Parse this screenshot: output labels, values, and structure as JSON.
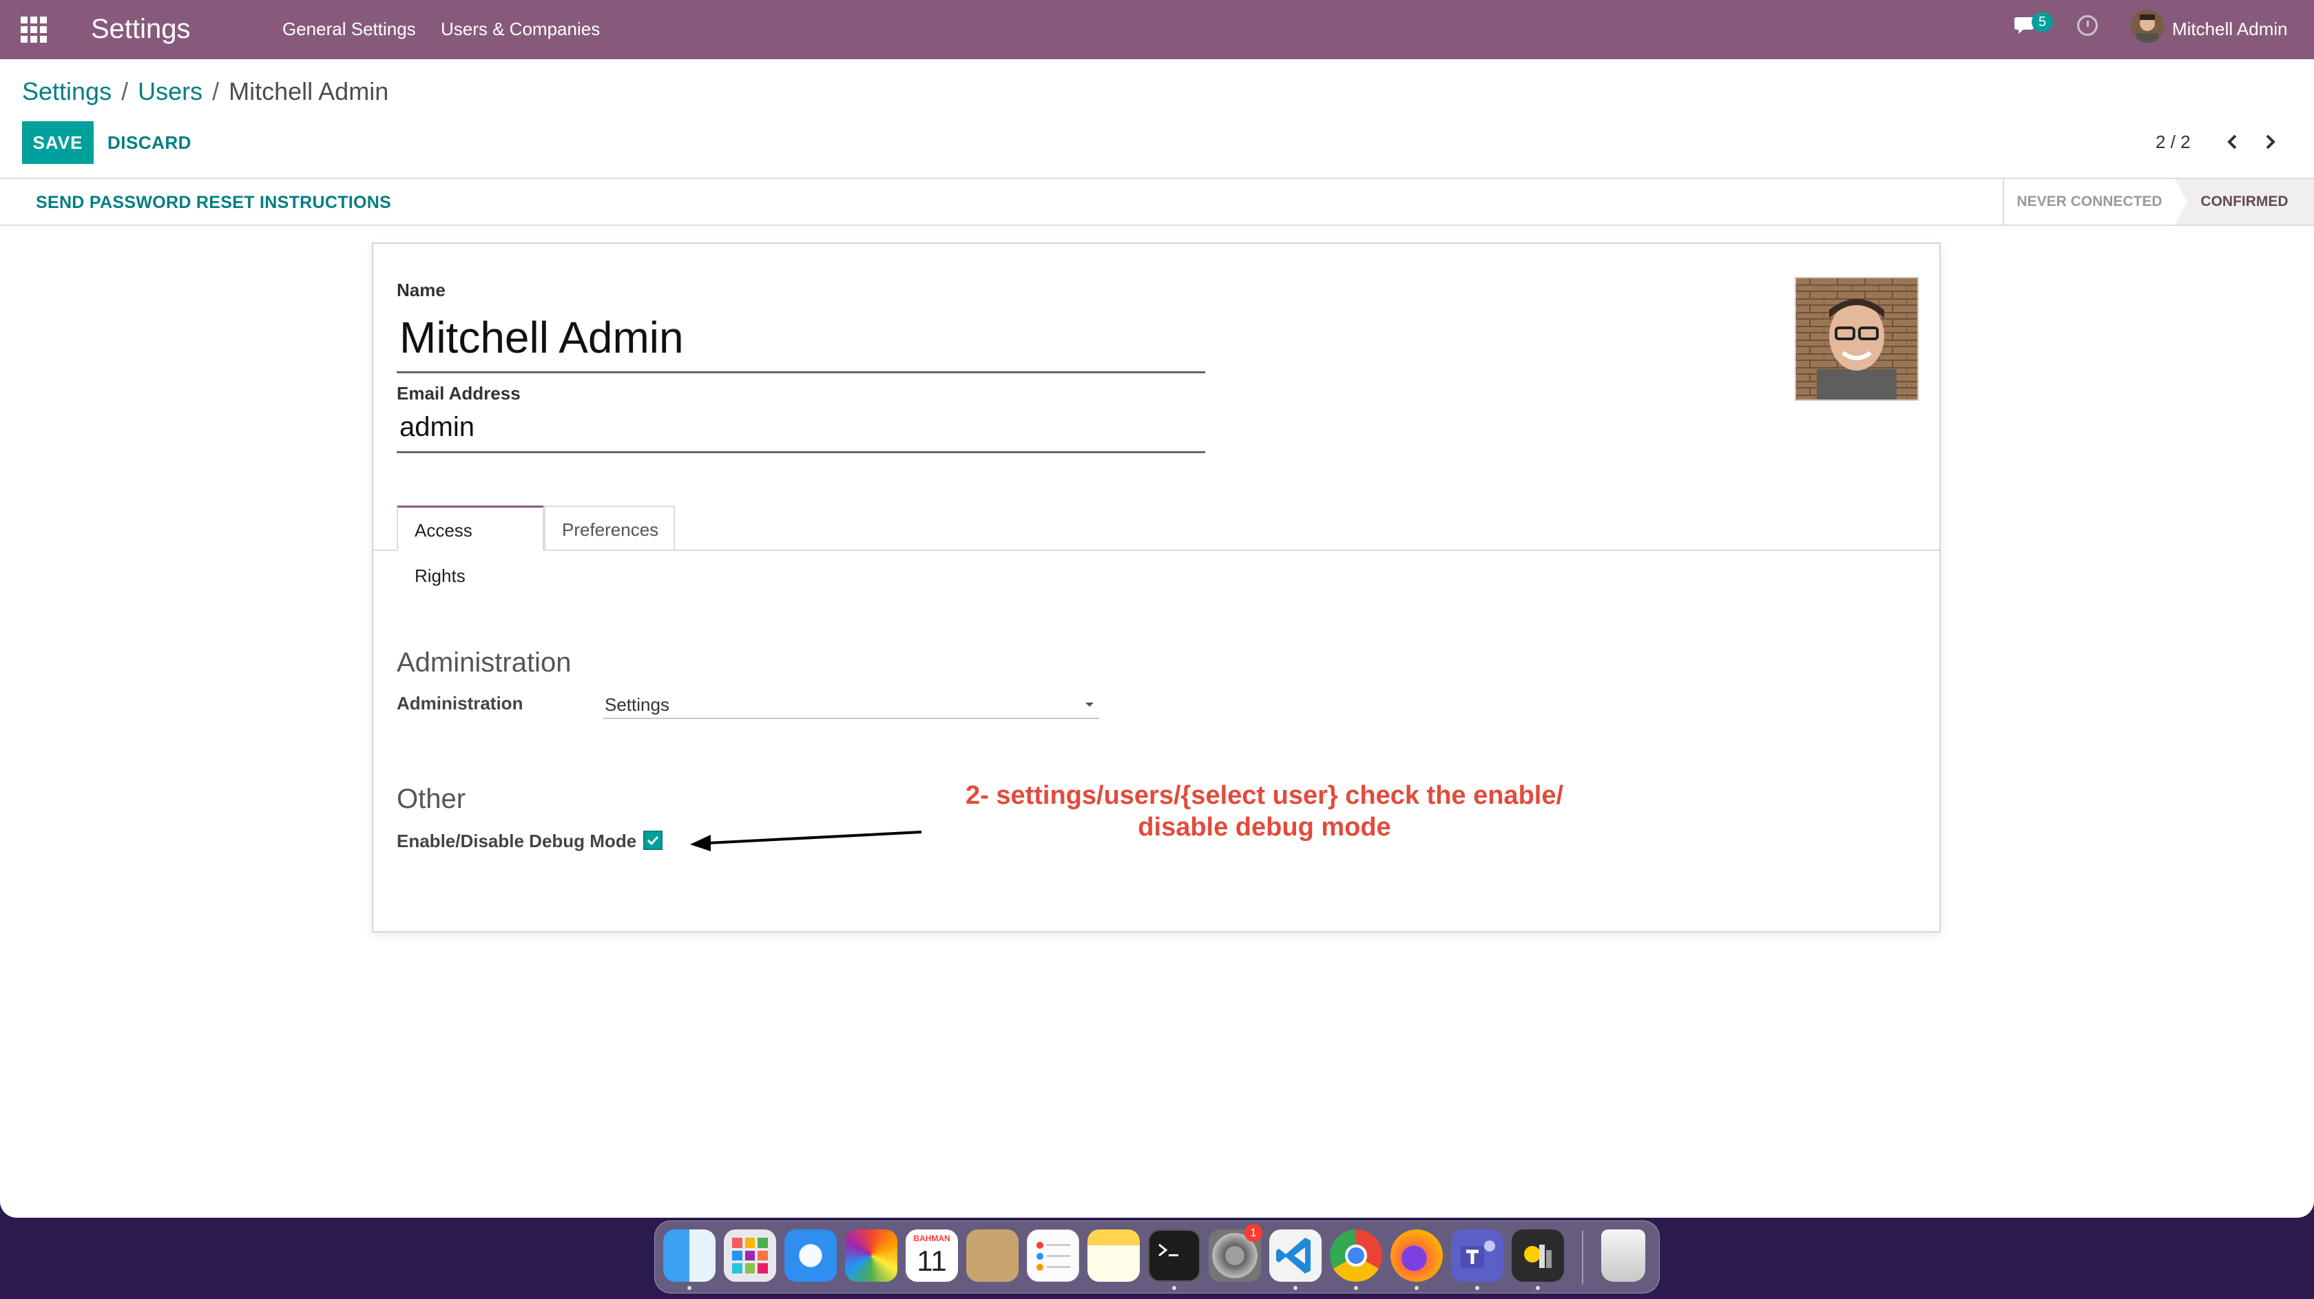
{
  "navbar": {
    "brand": "Settings",
    "menu": [
      "General Settings",
      "Users & Companies"
    ],
    "messages_count": "5",
    "user_name": "Mitchell Admin",
    "color": "#875a7b"
  },
  "breadcrumb": {
    "items": [
      "Settings",
      "Users"
    ],
    "current": "Mitchell Admin"
  },
  "buttons": {
    "save": "SAVE",
    "discard": "DISCARD",
    "reset_password": "SEND PASSWORD RESET INSTRUCTIONS"
  },
  "pager": {
    "value": "2 / 2"
  },
  "status": {
    "stages": [
      "NEVER CONNECTED",
      "CONFIRMED"
    ],
    "active": "CONFIRMED"
  },
  "form": {
    "name_label": "Name",
    "name_value": "Mitchell Admin",
    "email_label": "Email Address",
    "email_value": "admin",
    "tabs": [
      "Access Rights",
      "Preferences"
    ],
    "active_tab": "Access Rights",
    "admin_group_title": "Administration",
    "admin_field_label": "Administration",
    "admin_field_value": "Settings",
    "other_group_title": "Other",
    "debug_label": "Enable/Disable Debug Mode",
    "debug_checked": true
  },
  "annotation": {
    "line1": "2-  settings/users/{select user} check the enable/",
    "line2": "disable debug mode",
    "color": "#e24b3b"
  },
  "dock": {
    "apps": [
      "finder-icon",
      "launchpad-icon",
      "safari-icon",
      "photos-icon",
      "calendar-icon",
      "contacts-icon",
      "reminders-icon",
      "notes-icon",
      "terminal-icon",
      "system-preferences-icon",
      "vscode-icon",
      "chrome-icon",
      "firefox-icon",
      "teams-icon",
      "scripter-icon",
      "trash-icon"
    ],
    "calendar_month": "BAHMAN",
    "calendar_day": "11",
    "settings_badge": "1"
  },
  "colors": {
    "accent": "#00a09d",
    "link": "#017e84"
  }
}
